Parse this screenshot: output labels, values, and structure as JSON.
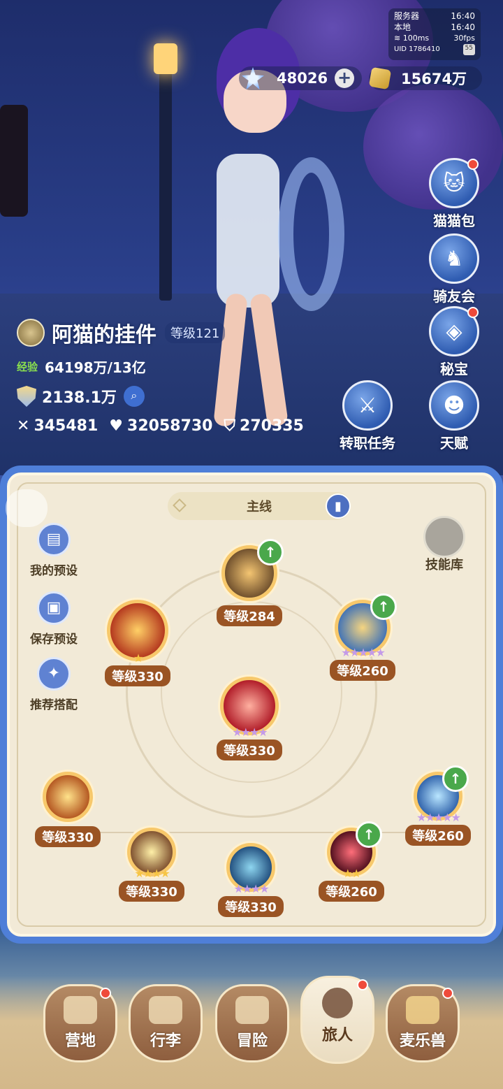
{
  "status": {
    "server_label": "服务器",
    "server_time": "16:40",
    "local_label": "本地",
    "local_time": "16:40",
    "ping": "100ms",
    "fps": "30fps",
    "uid": "UID 1786410",
    "battery": "55"
  },
  "currency": {
    "gems": "48026",
    "gold": "15674万"
  },
  "right_menu": {
    "cat_bag": "猫猫包",
    "rider_club": "骑友会",
    "treasure": "秘宝",
    "job_quest": "转职任务",
    "talent": "天赋"
  },
  "player": {
    "name": "阿猫的挂件",
    "level": "等级121",
    "exp_label": "经验",
    "exp_value": "64198万/13亿",
    "power": "2138.1万",
    "attack": "345481",
    "hp": "32058730",
    "defense": "270335"
  },
  "panel": {
    "tab": "主线",
    "my_preset": "我的预设",
    "save_preset": "保存预设",
    "recommend": "推荐搭配",
    "skill_library": "技能库"
  },
  "skills": [
    {
      "level": "等级284",
      "stars": "",
      "upgrade": true
    },
    {
      "level": "等级330",
      "stars": "★",
      "upgrade": false
    },
    {
      "level": "等级260",
      "stars": "★★★★★",
      "upgrade": true
    },
    {
      "level": "等级330",
      "stars": "★★★★",
      "upgrade": false
    },
    {
      "level": "等级330",
      "stars": "",
      "upgrade": false
    },
    {
      "level": "等级260",
      "stars": "★★★★★",
      "upgrade": true
    },
    {
      "level": "等级330",
      "stars": "★★★★",
      "upgrade": false
    },
    {
      "level": "等级330",
      "stars": "★★★★",
      "upgrade": false
    },
    {
      "level": "等级260",
      "stars": "★★",
      "upgrade": true
    }
  ],
  "nav": {
    "camp": "营地",
    "luggage": "行李",
    "adventure": "冒险",
    "traveler": "旅人",
    "beast": "麦乐兽"
  }
}
